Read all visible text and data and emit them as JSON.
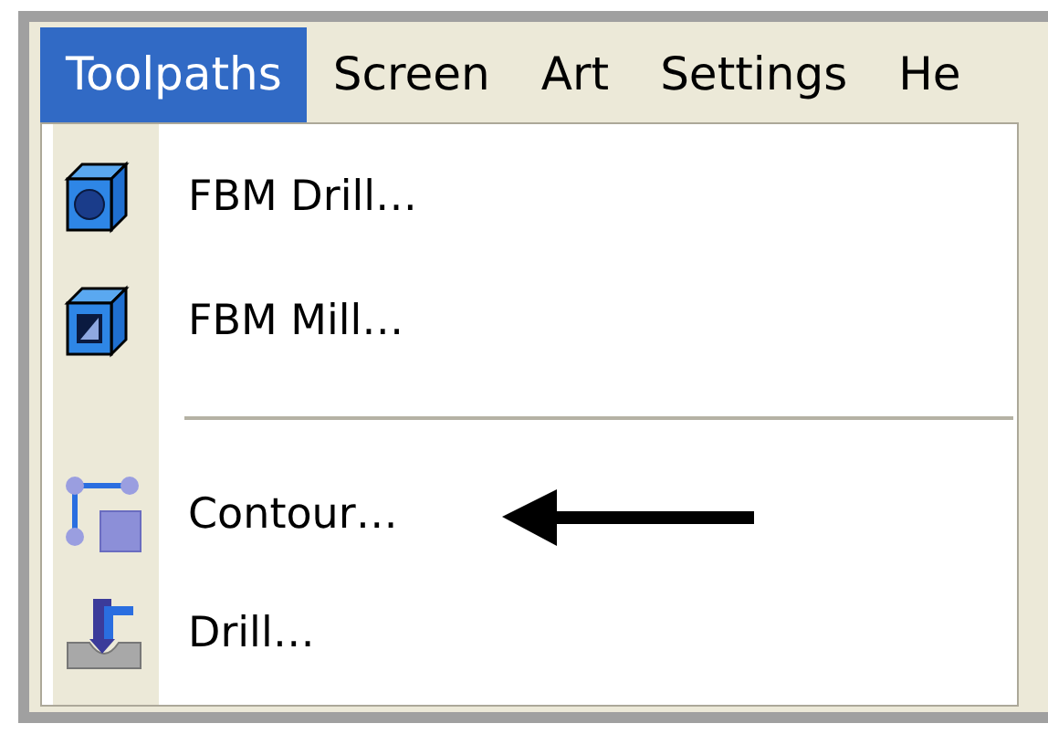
{
  "menu_bar": [
    {
      "label": "Toolpaths",
      "selected": true
    },
    {
      "label": "Screen",
      "selected": false
    },
    {
      "label": "Art",
      "selected": false
    },
    {
      "label": "Settings",
      "selected": false
    },
    {
      "label": "He",
      "selected": false
    }
  ],
  "dropdown": {
    "items": [
      {
        "kind": "item",
        "label": "FBM Drill…"
      },
      {
        "kind": "item",
        "label": "FBM Mill…"
      },
      {
        "kind": "separator"
      },
      {
        "kind": "item",
        "label": "Contour…"
      },
      {
        "kind": "item",
        "label": "Drill…"
      }
    ]
  }
}
